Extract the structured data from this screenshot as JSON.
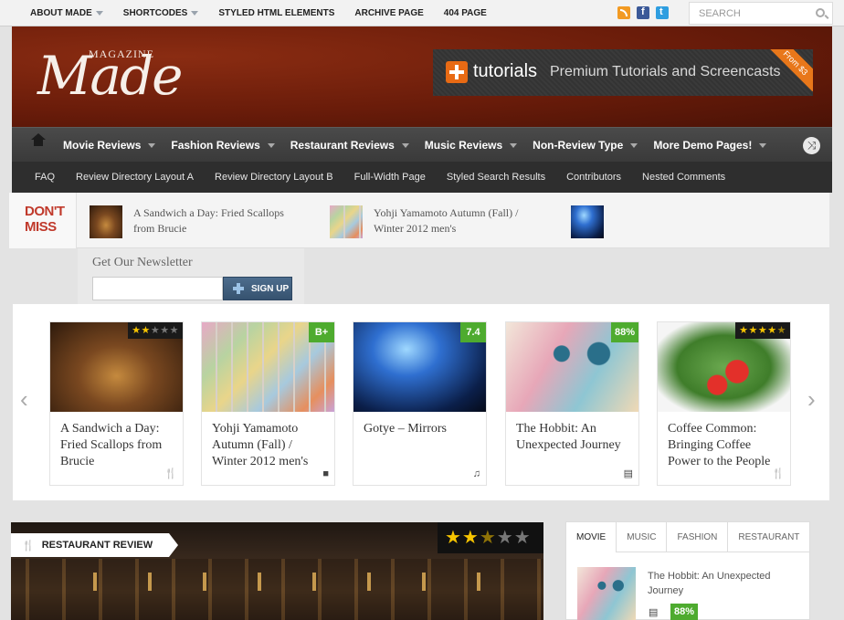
{
  "topbar": {
    "nav": [
      "ABOUT MADE",
      "SHORTCODES",
      "STYLED HTML ELEMENTS",
      "ARCHIVE PAGE",
      "404 PAGE"
    ],
    "nav_has_dropdown": [
      true,
      true,
      false,
      false,
      false
    ],
    "search_placeholder": "SEARCH",
    "social_icons": [
      "rss-icon",
      "facebook-icon",
      "twitter-icon"
    ]
  },
  "header": {
    "logo_small": "MAGAZINE",
    "logo_big": "Made",
    "banner": {
      "brand": "tutorials",
      "tagline": "Premium Tutorials and Screencasts",
      "ribbon": "From $3"
    }
  },
  "mainnav": {
    "items": [
      "Movie Reviews",
      "Fashion Reviews",
      "Restaurant Reviews",
      "Music Reviews",
      "Non-Review Type",
      "More Demo Pages!"
    ]
  },
  "subnav": {
    "items": [
      "FAQ",
      "Review Directory Layout A",
      "Review Directory Layout B",
      "Full-Width Page",
      "Styled Search Results",
      "Contributors",
      "Nested Comments"
    ]
  },
  "dontmiss": {
    "label_line1": "DON'T",
    "label_line2": "MISS",
    "items": [
      {
        "title": "A Sandwich a Day: Fried Scallops from Brucie"
      },
      {
        "title": "Yohji Yamamoto Autumn (Fall) / Winter 2012 men's"
      }
    ]
  },
  "newsletter": {
    "title": "Get Our Newsletter",
    "button": "SIGN UP"
  },
  "carousel": {
    "cards": [
      {
        "title": "A Sandwich a Day: Fried Scallops from Brucie",
        "rating_stars": 2,
        "category_icon": "restaurant-icon"
      },
      {
        "title": "Yohji Yamamoto Autumn (Fall) / Winter 2012 men's",
        "rating_grade": "B+",
        "category_icon": "fashion-icon"
      },
      {
        "title": "Gotye – Mirrors",
        "rating_score": "7.4",
        "category_icon": "music-icon"
      },
      {
        "title": "The Hobbit: An Unexpected Journey",
        "rating_percent": "88%",
        "category_icon": "movie-icon"
      },
      {
        "title": "Coffee Common: Bringing Coffee Power to the People",
        "rating_stars": 4.5,
        "category_icon": "restaurant-icon"
      }
    ]
  },
  "featured": {
    "label": "RESTAURANT REVIEW",
    "rating_stars": 2.5
  },
  "tabs_widget": {
    "tabs": [
      "MOVIE",
      "MUSIC",
      "FASHION",
      "RESTAURANT"
    ],
    "active_tab": "MOVIE",
    "item": {
      "title": "The Hobbit: An Unexpected Journey",
      "score": "88%"
    }
  },
  "colors": {
    "header_red": "#6a1c0a",
    "nav_dark": "#3a3a3a",
    "dontmiss_red": "#c0392b",
    "score_green": "#4eab2f",
    "star_yellow": "#f6c400"
  }
}
